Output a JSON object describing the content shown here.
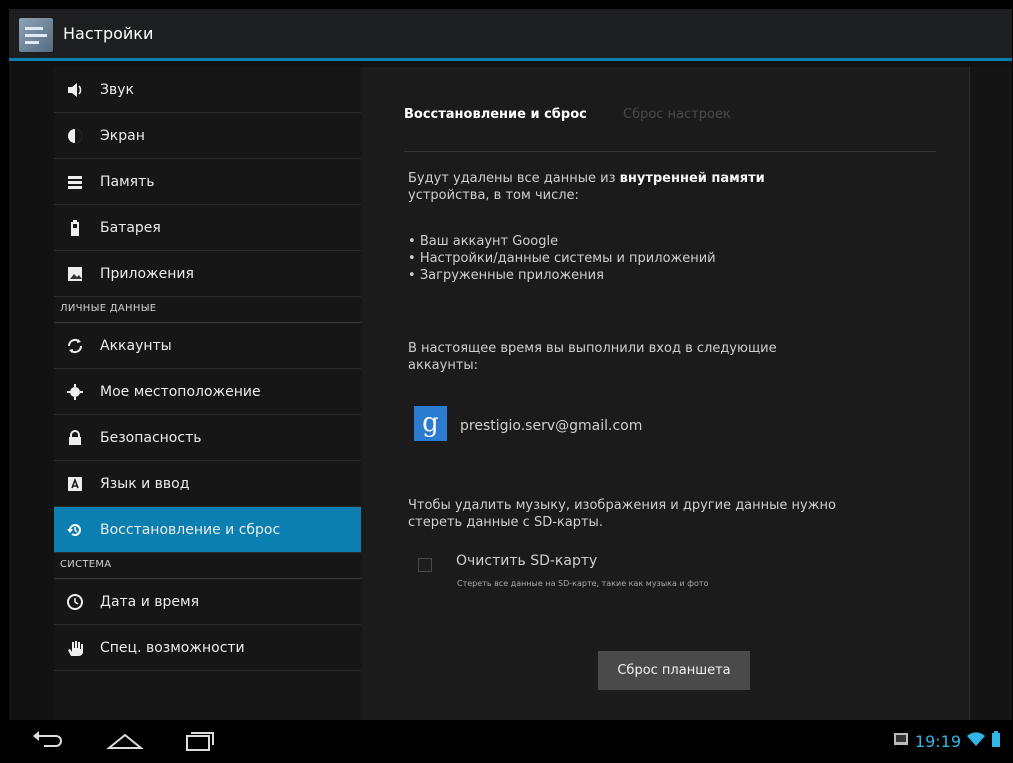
{
  "app": {
    "title": "Настройки"
  },
  "sidebar": {
    "items": [
      {
        "label": "Звук",
        "icon": "speaker-icon"
      },
      {
        "label": "Экран",
        "icon": "brightness-icon"
      },
      {
        "label": "Память",
        "icon": "storage-icon"
      },
      {
        "label": "Батарея",
        "icon": "battery-icon"
      },
      {
        "label": "Приложения",
        "icon": "apps-icon"
      },
      {
        "label": "Аккаунты",
        "icon": "sync-icon"
      },
      {
        "label": "Мое местоположение",
        "icon": "location-icon"
      },
      {
        "label": "Безопасность",
        "icon": "lock-icon"
      },
      {
        "label": "Язык и ввод",
        "icon": "keyboard-icon"
      },
      {
        "label": "Восстановление и сброс",
        "icon": "restore-icon",
        "active": true
      },
      {
        "label": "Дата и время",
        "icon": "clock-icon"
      },
      {
        "label": "Спец. возможности",
        "icon": "hand-icon"
      }
    ],
    "headers": {
      "personal": "ЛИЧНЫЕ ДАННЫЕ",
      "system": "СИСТЕМА"
    }
  },
  "content": {
    "breadcrumb_main": "Восстановление и сброс",
    "breadcrumb_sub": "Сброс настроек",
    "warning_prefix": "Будут удалены все данные из ",
    "warning_bold": "внутренней памяти",
    "warning_suffix": "устройства, в том числе:",
    "bullets": [
      "Ваш аккаунт Google",
      "Настройки/данные системы и приложений",
      "Загруженные приложения"
    ],
    "accounts_line1": "В настоящее время вы выполнили вход в следующие",
    "accounts_line2": "аккаунты:",
    "account_logo_letter": "g",
    "account_email": "prestigio.serv@gmail.com",
    "sd_line1": "Чтобы удалить музыку, изображения и другие данные нужно",
    "sd_line2": "стереть данные с SD-карты.",
    "sd_checkbox_title": "Очистить SD-карту",
    "sd_checkbox_sub": "Стереть все данные на SD-карте, такие как музыка и фото",
    "sd_checked": false,
    "reset_button": "Сброс планшета"
  },
  "statusbar": {
    "time": "19:19"
  },
  "colors": {
    "accent": "#0a7fb0",
    "clock": "#33b5e5"
  }
}
